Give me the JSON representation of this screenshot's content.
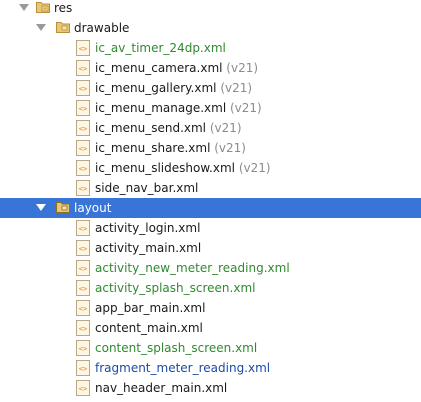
{
  "tree": {
    "res": {
      "label": "res"
    },
    "drawable": {
      "label": "drawable",
      "files": [
        {
          "name": "ic_av_timer_24dp.xml",
          "suffix": "",
          "status": "green"
        },
        {
          "name": "ic_menu_camera.xml",
          "suffix": " (v21)",
          "status": "normal"
        },
        {
          "name": "ic_menu_gallery.xml",
          "suffix": " (v21)",
          "status": "normal"
        },
        {
          "name": "ic_menu_manage.xml",
          "suffix": " (v21)",
          "status": "normal"
        },
        {
          "name": "ic_menu_send.xml",
          "suffix": " (v21)",
          "status": "normal"
        },
        {
          "name": "ic_menu_share.xml",
          "suffix": " (v21)",
          "status": "normal"
        },
        {
          "name": "ic_menu_slideshow.xml",
          "suffix": " (v21)",
          "status": "normal"
        },
        {
          "name": "side_nav_bar.xml",
          "suffix": "",
          "status": "normal"
        }
      ]
    },
    "layout": {
      "label": "layout",
      "files": [
        {
          "name": "activity_login.xml",
          "status": "normal"
        },
        {
          "name": "activity_main.xml",
          "status": "normal"
        },
        {
          "name": "activity_new_meter_reading.xml",
          "status": "green"
        },
        {
          "name": "activity_splash_screen.xml",
          "status": "green"
        },
        {
          "name": "app_bar_main.xml",
          "status": "normal"
        },
        {
          "name": "content_main.xml",
          "status": "normal"
        },
        {
          "name": "content_splash_screen.xml",
          "status": "green"
        },
        {
          "name": "fragment_meter_reading.xml",
          "status": "blue"
        },
        {
          "name": "nav_header_main.xml",
          "status": "normal"
        }
      ]
    }
  },
  "colors": {
    "selection": "#3875d6",
    "added_file": "#2f8a2f",
    "modified_file": "#1c4aa6",
    "version_suffix": "#8c8c8c"
  }
}
